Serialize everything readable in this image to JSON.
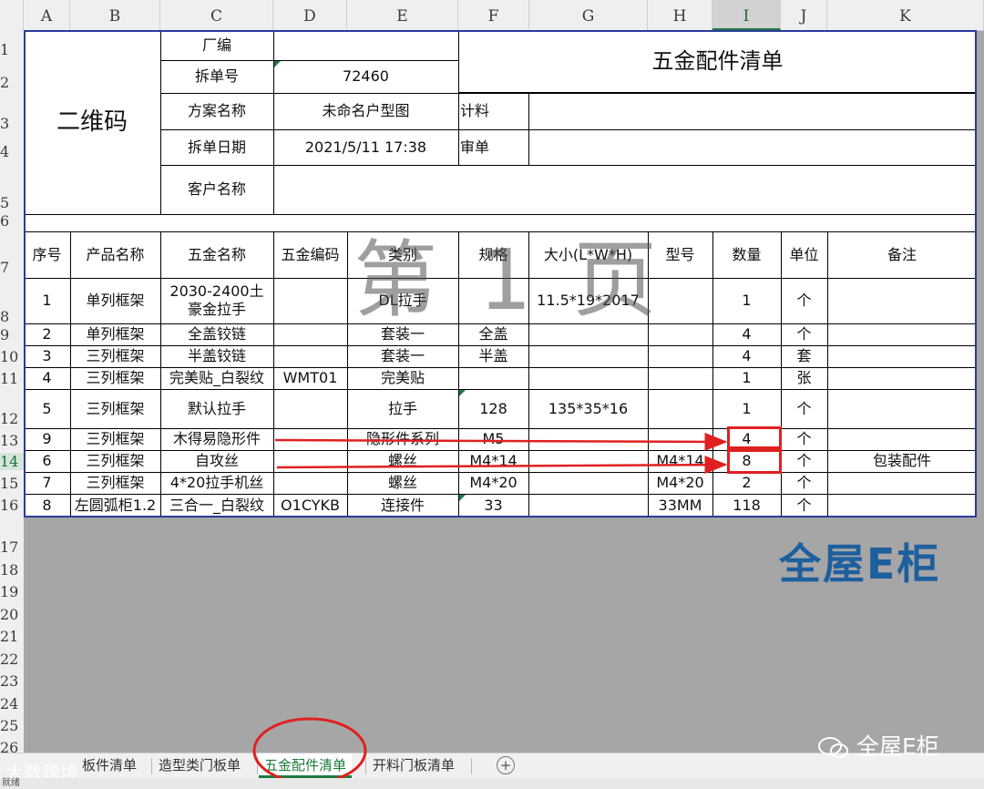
{
  "columns": [
    "A",
    "B",
    "C",
    "D",
    "E",
    "F",
    "G",
    "H",
    "I",
    "J",
    "K"
  ],
  "selected_column": "I",
  "rows": [
    "1",
    "2",
    "3",
    "4",
    "5",
    "6",
    "7",
    "8",
    "9",
    "10",
    "11",
    "12",
    "13",
    "14",
    "15",
    "16",
    "17",
    "18",
    "19",
    "20",
    "21",
    "22",
    "23",
    "24",
    "25",
    "26"
  ],
  "selected_row": "14",
  "header": {
    "qr_label": "二维码",
    "title": "五金配件清单",
    "factory_label": "厂编",
    "factory_value": "",
    "order_no_label": "拆单号",
    "order_no_value": "72460",
    "plan_label": "方案名称",
    "plan_value": "未命名户型图",
    "count_label": "计料",
    "date_label": "拆单日期",
    "date_value": "2021/5/11 17:38",
    "review_label": "审单",
    "customer_label": "客户名称"
  },
  "table": {
    "columns": [
      "序号",
      "产品名称",
      "五金名称",
      "五金编码",
      "类别",
      "规格",
      "大小(L*W*H)",
      "型号",
      "数量",
      "单位",
      "备注"
    ],
    "rows": [
      [
        "1",
        "单列框架",
        "2030-2400土豪金拉手",
        "",
        "DL拉手",
        "",
        "11.5*19*2017",
        "",
        "1",
        "个",
        ""
      ],
      [
        "2",
        "单列框架",
        "全盖铰链",
        "",
        "套装一",
        "全盖",
        "",
        "",
        "4",
        "个",
        ""
      ],
      [
        "3",
        "三列框架",
        "半盖铰链",
        "",
        "套装一",
        "半盖",
        "",
        "",
        "4",
        "套",
        ""
      ],
      [
        "4",
        "三列框架",
        "完美贴_白裂纹",
        "WMT01",
        "完美贴",
        "",
        "",
        "",
        "1",
        "张",
        ""
      ],
      [
        "5",
        "三列框架",
        "默认拉手",
        "",
        "拉手",
        "128",
        "135*35*16",
        "",
        "1",
        "个",
        ""
      ],
      [
        "9",
        "三列框架",
        "木得易隐形件",
        "",
        "隐形件系列",
        "M5",
        "",
        "",
        "4",
        "个",
        ""
      ],
      [
        "6",
        "三列框架",
        "自攻丝",
        "",
        "螺丝",
        "M4*14",
        "",
        "M4*14",
        "8",
        "个",
        "包装配件"
      ],
      [
        "7",
        "三列框架",
        "4*20拉手机丝",
        "",
        "螺丝",
        "M4*20",
        "",
        "M4*20",
        "2",
        "个",
        ""
      ],
      [
        "8",
        "左圆弧柜1.2",
        "三合一_白裂纹",
        "O1CYKB",
        "连接件",
        "33",
        "",
        "33MM",
        "118",
        "个",
        ""
      ]
    ]
  },
  "watermark": "第 1 页",
  "tabs": [
    "板件清单",
    "造型类门板单",
    "五金配件清单",
    "开料门板清单"
  ],
  "active_tab": "五金配件清单",
  "add_sheet_icon": "plus-circle-icon",
  "status_text": "就绪",
  "brand_logo": "全屋E柜",
  "wechat_label": "全屋E柜",
  "source_mark": "大数跨境",
  "colors": {
    "sheet_border": "#2b3b9a",
    "highlight": "#e02020",
    "active_tab": "#1e7a3e",
    "gray_area": "#a6a6a6"
  }
}
